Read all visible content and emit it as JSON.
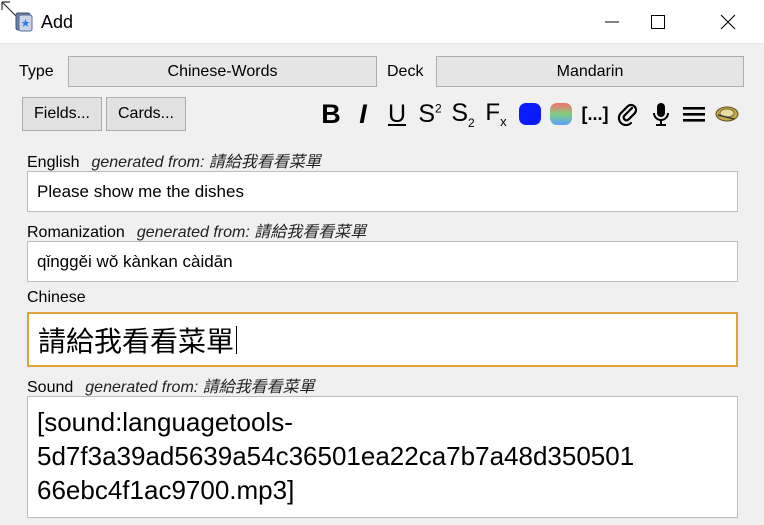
{
  "window": {
    "title": "Add"
  },
  "toolbar_row": {
    "type_label": "Type",
    "type_value": "Chinese-Words",
    "deck_label": "Deck",
    "deck_value": "Mandarin"
  },
  "buttons": {
    "fields": "Fields...",
    "cards": "Cards..."
  },
  "format": {
    "bold": "B",
    "italic": "I",
    "underline": "U",
    "superscript": "S",
    "superscript_mark": "2",
    "subscript": "S",
    "subscript_mark": "2",
    "clear": "F",
    "clear_mark": "x",
    "cloze": "[...]",
    "color_fill": "#0a1cff"
  },
  "fields": [
    {
      "name": "English",
      "generated": "generated from:",
      "source": "請給我看看菜單",
      "value": "Please show me the dishes"
    },
    {
      "name": "Romanization",
      "generated": "generated from:",
      "source": "請給我看看菜單",
      "value": "qǐnggěi wǒ kànkan càidān"
    },
    {
      "name": "Chinese",
      "value": "請給我看看菜單"
    },
    {
      "name": "Sound",
      "generated": "generated from:",
      "source": "請給我看看菜單",
      "lines": [
        "[sound:languagetools-",
        "5d7f3a39ad5639a54c36501ea22ca7b7a48d350501",
        "66ebc4f1ac9700.mp3]"
      ]
    }
  ],
  "colors": {
    "accent": "#e0a33b"
  }
}
